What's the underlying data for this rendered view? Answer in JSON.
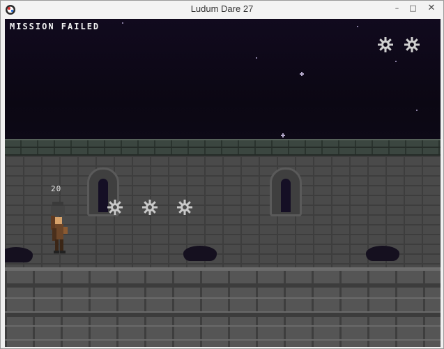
{
  "window": {
    "title": "Ludum Dare 27",
    "controls": {
      "minimize": "–",
      "maximize": "□",
      "close": "✕"
    },
    "icon": "ludum-dare-app-icon"
  },
  "game": {
    "status_text": "MISSION FAILED",
    "player_score": "20",
    "lives_icons": [
      "gear-icon",
      "gear-icon"
    ],
    "row_gears": [
      "gear-icon",
      "gear-icon",
      "gear-icon"
    ],
    "colors": {
      "sky": "#0c0715",
      "wall": "#4a4a4a",
      "ground": "#555555",
      "text": "#f2f2f2"
    }
  }
}
